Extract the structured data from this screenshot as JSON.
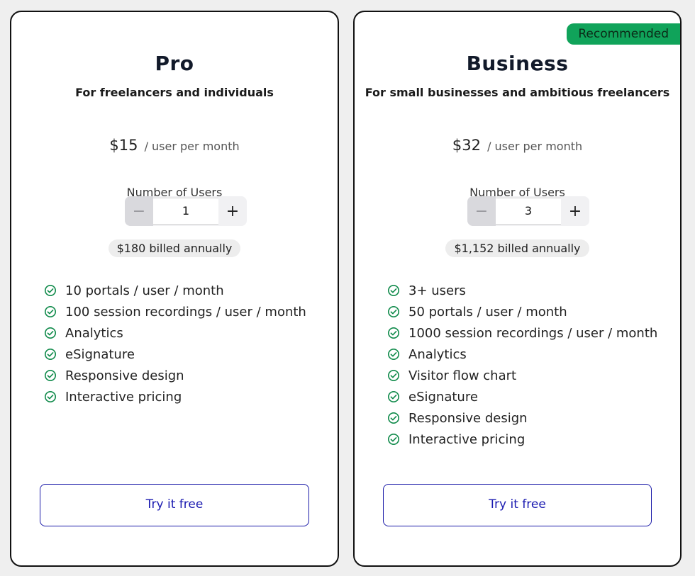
{
  "colors": {
    "accent_green": "#10a35a",
    "cta_blue": "#1a1ab0",
    "card_border": "#111111",
    "background": "#efefef"
  },
  "plans": [
    {
      "title": "Pro",
      "subtitle": "For freelancers and individuals",
      "price": "$15",
      "price_unit": "/ user per month",
      "users_label": "Number of Users",
      "users": "1",
      "minus_label": "−",
      "plus_label": "+",
      "billed": "$180 billed annually",
      "features": [
        "10 portals / user / month",
        "100 session recordings / user / month",
        "Analytics",
        "eSignature",
        "Responsive design",
        "Interactive pricing"
      ],
      "cta": "Try it free"
    },
    {
      "badge": "Recommended",
      "title": "Business",
      "subtitle": "For small businesses and ambitious freelancers",
      "price": "$32",
      "price_unit": "/ user per month",
      "users_label": "Number of Users",
      "users": "3",
      "minus_label": "−",
      "plus_label": "+",
      "billed": "$1,152 billed annually",
      "features": [
        "3+ users",
        "50 portals / user / month",
        "1000 session recordings / user / month",
        "Analytics",
        "Visitor flow chart",
        "eSignature",
        "Responsive design",
        "Interactive pricing"
      ],
      "cta": "Try it free"
    }
  ]
}
